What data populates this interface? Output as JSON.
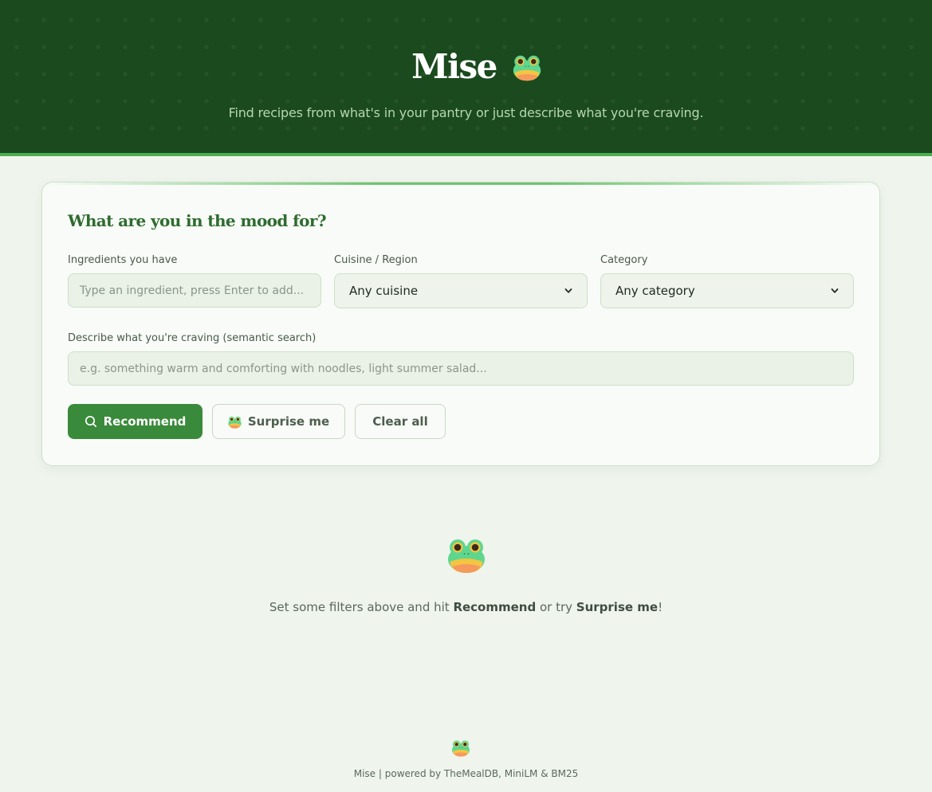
{
  "header": {
    "title": "Mise",
    "tagline": "Find recipes from what's in your pantry or just describe what you're craving."
  },
  "card": {
    "title": "What are you in the mood for?",
    "ingredients": {
      "label": "Ingredients you have",
      "placeholder": "Type an ingredient, press Enter to add..."
    },
    "cuisine": {
      "label": "Cuisine / Region",
      "selected": "Any cuisine"
    },
    "category": {
      "label": "Category",
      "selected": "Any category"
    },
    "craving": {
      "label": "Describe what you're craving (semantic search)",
      "placeholder": "e.g. something warm and comforting with noodles, light summer salad..."
    },
    "buttons": {
      "recommend": "Recommend",
      "surprise": "Surprise me",
      "clear": "Clear all"
    }
  },
  "empty_state": {
    "prefix": "Set some filters above and hit ",
    "recommend": "Recommend",
    "middle": " or try ",
    "surprise": "Surprise me",
    "suffix": "!"
  },
  "footer": {
    "text": "Mise | powered by TheMealDB, MiniLM & BM25"
  },
  "colors": {
    "header_bg": "#1a4a1d",
    "accent": "#4caf50",
    "primary_button": "#3a8a3b",
    "title_green": "#2e6b2f"
  },
  "icons": {
    "logo": "frog-icon",
    "search": "search-icon",
    "dropdown": "chevron-down-icon"
  }
}
